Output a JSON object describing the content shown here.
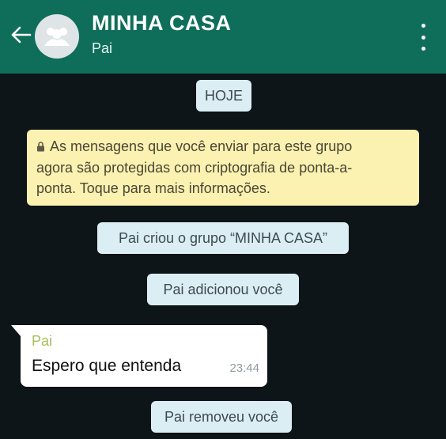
{
  "header": {
    "title": "MINHA CASA",
    "subtitle": "Pai",
    "back_icon": "arrow-left-icon",
    "avatar_icon": "group-avatar-icon",
    "menu_icon": "more-vertical-icon",
    "color": "#0f6e5a"
  },
  "chat": {
    "date_label": "HOJE",
    "security_notice": "As mensagens que você enviar para este grupo agora são protegidas com criptografia de ponta-a-ponta. Toque para mais informações.",
    "security_notice_lines": [
      "As mensagens que você enviar para este grupo",
      "agora são protegidas com criptografia de ponta-a-",
      "ponta. Toque para mais informações."
    ],
    "events": [
      "Pai criou o grupo “MINHA CASA”",
      "Pai adicionou você",
      "Pai removeu você"
    ],
    "message": {
      "sender": "Pai",
      "text": "Espero que entenda",
      "time": "23:44"
    }
  },
  "colors": {
    "header_bg": "#0f6e5a",
    "chat_bg": "#0e1518",
    "system_pill": "#dbeef3",
    "security_bg": "#fbf1b0",
    "sender_name": "#a5bf55"
  }
}
